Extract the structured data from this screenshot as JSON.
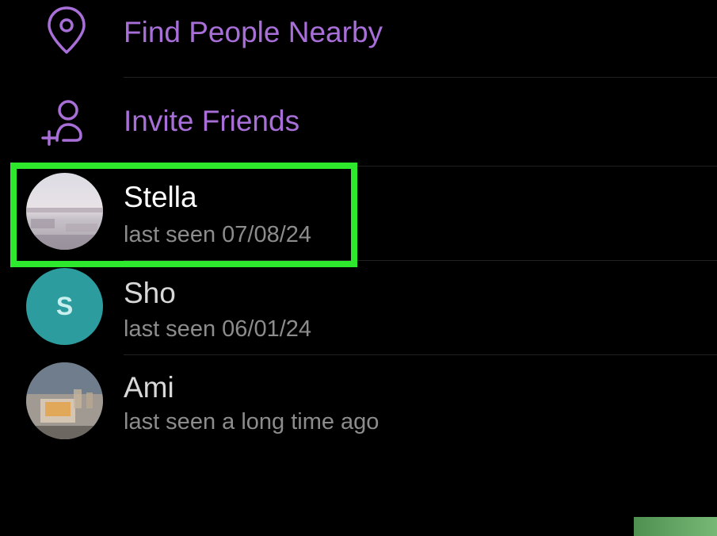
{
  "actions": [
    {
      "label": "Find People Nearby",
      "icon": "location-pin-icon"
    },
    {
      "label": "Invite Friends",
      "icon": "add-person-icon"
    }
  ],
  "contacts": [
    {
      "name": "Stella",
      "status": "last seen 07/08/24",
      "avatar": "photo",
      "name_color": "#ffffff"
    },
    {
      "name": "Sho",
      "status": "last seen 06/01/24",
      "avatar_letter": "S",
      "avatar_color": "#2c9c9e",
      "name_color": "#d8d8d8"
    },
    {
      "name": "Ami",
      "status": "last seen a long time ago",
      "avatar": "photo",
      "name_color": "#d8d8d8"
    }
  ],
  "colors": {
    "accent": "#a96fd8",
    "highlight": "#2ee82e",
    "background": "#000000",
    "status_text": "#8c8c8c"
  }
}
